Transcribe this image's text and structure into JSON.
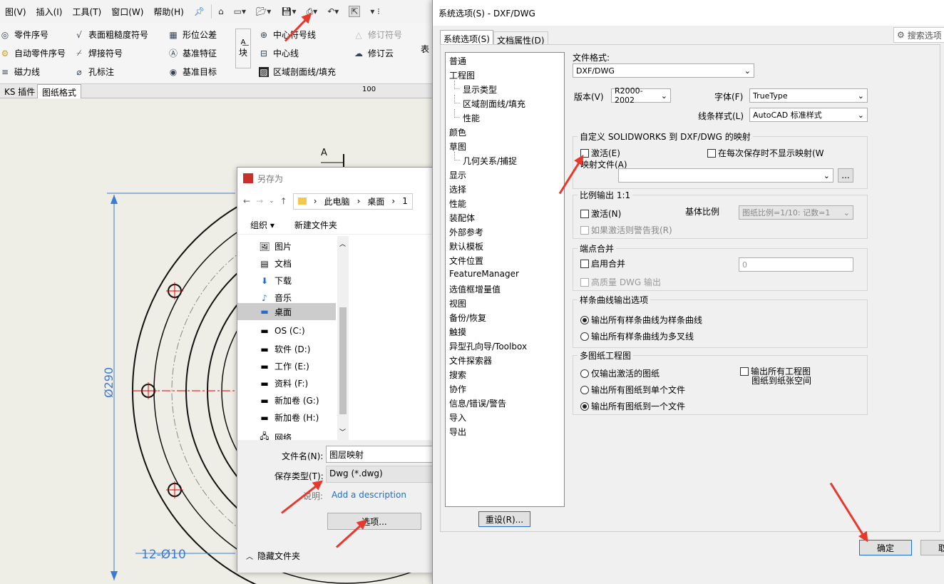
{
  "menubar": {
    "items": [
      "图(V)",
      "插入(I)",
      "工具(T)",
      "窗口(W)",
      "帮助(H)"
    ]
  },
  "ribbon": {
    "col1": [
      "零件序号",
      "自动零件序号",
      "磁力线"
    ],
    "col2": [
      "表面粗糙度符号",
      "焊接符号",
      "孔标注"
    ],
    "col3": [
      "形位公差",
      "基准特征",
      "基准目标"
    ],
    "block": "块",
    "col4": [
      "中心符号线",
      "中心线",
      "区域剖面线/填充"
    ],
    "col5": [
      "修订符号",
      "修订云"
    ],
    "table": "表"
  },
  "sheettabs": {
    "t1": "KS 插件",
    "t2": "图纸格式",
    "ruler_mark": "100"
  },
  "drawing": {
    "section_label": "A",
    "dim_vertical": "Ø290",
    "dim_holes": "12-Ø10"
  },
  "saveas": {
    "title": "另存为",
    "breadcrumb": [
      "此电脑",
      "桌面",
      "1"
    ],
    "toolbar": {
      "organize": "组织 ▾",
      "new_folder": "新建文件夹"
    },
    "nav": [
      "图片",
      "文档",
      "下载",
      "音乐",
      "桌面",
      "OS (C:)",
      "软件 (D:)",
      "工作 (E:)",
      "资料 (F:)",
      "新加卷 (G:)",
      "新加卷 (H:)",
      "网络"
    ],
    "filename_label": "文件名(N):",
    "filename_value": "图层映射",
    "type_label": "保存类型(T):",
    "type_value": "Dwg (*.dwg)",
    "desc_label": "说明:",
    "desc_link": "Add a description",
    "options_button": "选项...",
    "hide_folders": "隐藏文件夹"
  },
  "sysopt": {
    "title": "系统选项(S) - DXF/DWG",
    "tabs": [
      "系统选项(S)",
      "文档属性(D)"
    ],
    "search": "搜索选项",
    "tree": [
      "普通",
      "工程图",
      "显示类型",
      "区域剖面线/填充",
      "性能",
      "颜色",
      "草图",
      "几何关系/捕捉",
      "显示",
      "选择",
      "性能",
      "装配体",
      "外部参考",
      "默认模板",
      "文件位置",
      "FeatureManager",
      "选值框增量值",
      "视图",
      "备份/恢复",
      "触摸",
      "异型孔向导/Toolbox",
      "文件探索器",
      "搜索",
      "协作",
      "信息/错误/警告",
      "导入",
      "导出"
    ],
    "reset": "重设(R)...",
    "file_format_label": "文件格式:",
    "file_format": "DXF/DWG",
    "version_label": "版本(V)",
    "version": "R2000-2002",
    "font_label": "字体(F)",
    "font": "TrueType",
    "linestyle_label": "线条样式(L)",
    "linestyle": "AutoCAD 标准样式",
    "map_group": "自定义 SOLIDWORKS 到 DXF/DWG 的映射",
    "map_activate": "激活(E)",
    "map_noshow": "在每次保存时不显示映射(W",
    "map_file_label": "映射文件(A)",
    "browse": "...",
    "scale_group": "比例输出 1:1",
    "scale_activate": "激活(N)",
    "base_scale_label": "基体比例",
    "base_scale": "图纸比例=1/10: 记数=1",
    "scale_warn": "如果激活则警告我(R)",
    "merge_group": "端点合并",
    "merge_enable": "启用合并",
    "merge_value": "0",
    "hq_dwg": "高质量 DWG 输出",
    "spline_group": "样条曲线输出选项",
    "spline_opt1": "输出所有样条曲线为样条曲线",
    "spline_opt2": "输出所有样条曲线为多叉线",
    "multi_group": "多图纸工程图",
    "multi_opt1": "仅输出激活的图纸",
    "multi_opt2": "输出所有图纸到单个文件",
    "multi_opt3": "输出所有图纸到一个文件",
    "multi_paperspace_l1": "输出所有工程图",
    "multi_paperspace_l2": "图纸到纸张空间",
    "ok": "确定",
    "cancel": "取"
  }
}
